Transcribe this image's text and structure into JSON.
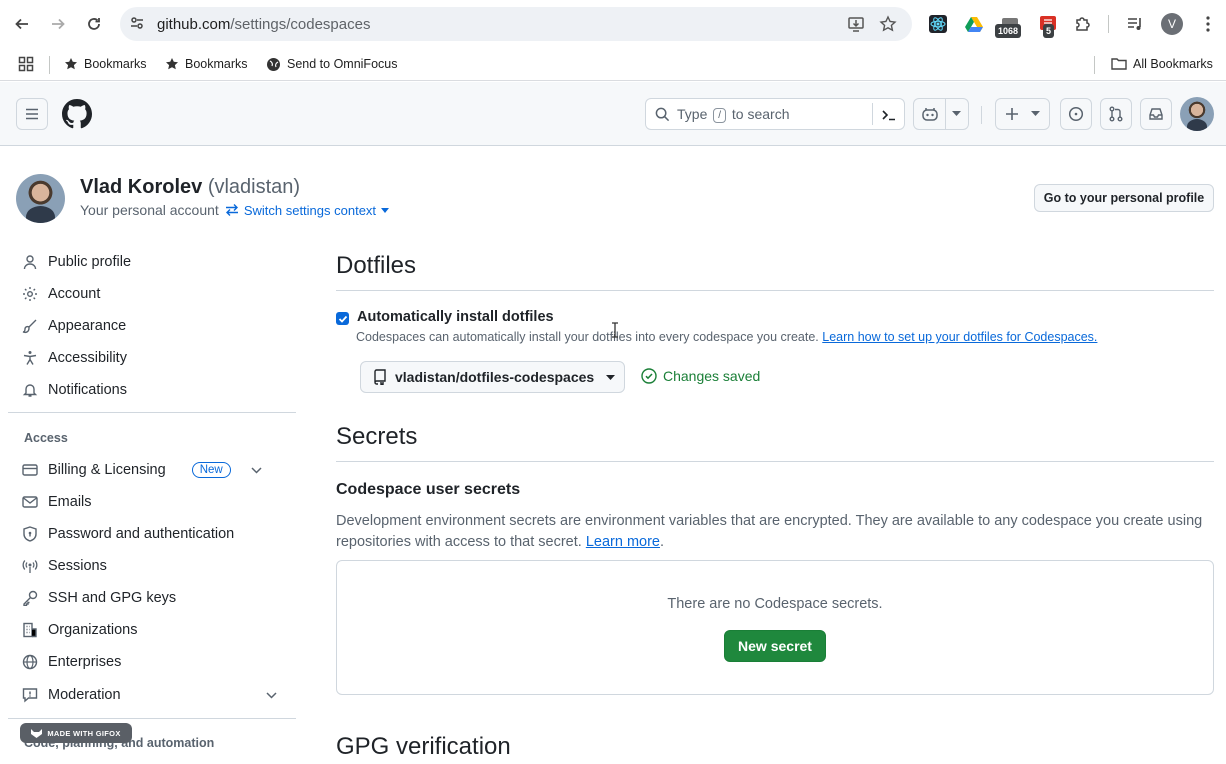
{
  "browser": {
    "url_host": "github.com",
    "url_path": "/settings/codespaces",
    "extension_badges": [
      "1068",
      "5"
    ],
    "profile_initial": "V",
    "bookmarks": [
      "Bookmarks",
      "Bookmarks",
      "Send to OmniFocus"
    ],
    "all_bookmarks": "All Bookmarks"
  },
  "header": {
    "search_placeholder_before": "Type",
    "search_key": "/",
    "search_placeholder_after": "to search"
  },
  "profile": {
    "name": "Vlad Korolev",
    "login": "(vladistan)",
    "subtitle": "Your personal account",
    "switch_context": "Switch settings context",
    "go_profile_button": "Go to your personal profile"
  },
  "sidebar": {
    "items_top": [
      "Public profile",
      "Account",
      "Appearance",
      "Accessibility",
      "Notifications"
    ],
    "access_heading": "Access",
    "billing": "Billing & Licensing",
    "billing_badge": "New",
    "items_access": [
      "Emails",
      "Password and authentication",
      "Sessions",
      "SSH and GPG keys",
      "Organizations",
      "Enterprises"
    ],
    "moderation": "Moderation",
    "code_heading": "Code, planning, and automation"
  },
  "main": {
    "dotfiles_title": "Dotfiles",
    "auto_install_label": "Automatically install dotfiles",
    "auto_install_checked": true,
    "auto_install_desc": "Codespaces can automatically install your dotfiles into every codespace you create.",
    "auto_install_link": "Learn how to set up your dotfiles for Codespaces.",
    "repo_selected": "vladistan/dotfiles-codespaces",
    "saved_status": "Changes saved",
    "secrets_title": "Secrets",
    "user_secrets_title": "Codespace user secrets",
    "user_secrets_desc": "Development environment secrets are environment variables that are encrypted. They are available to any codespace you create using repositories with access to that secret.",
    "learn_more": "Learn more",
    "learn_more_suffix": ".",
    "empty_secrets": "There are no Codespace secrets.",
    "new_secret_button": "New secret",
    "gpg_title": "GPG verification"
  },
  "watermark": "MADE WITH GIFOX",
  "colors": {
    "accent": "#0969da",
    "success": "#1a7f37",
    "primary_button": "#1f883d"
  }
}
